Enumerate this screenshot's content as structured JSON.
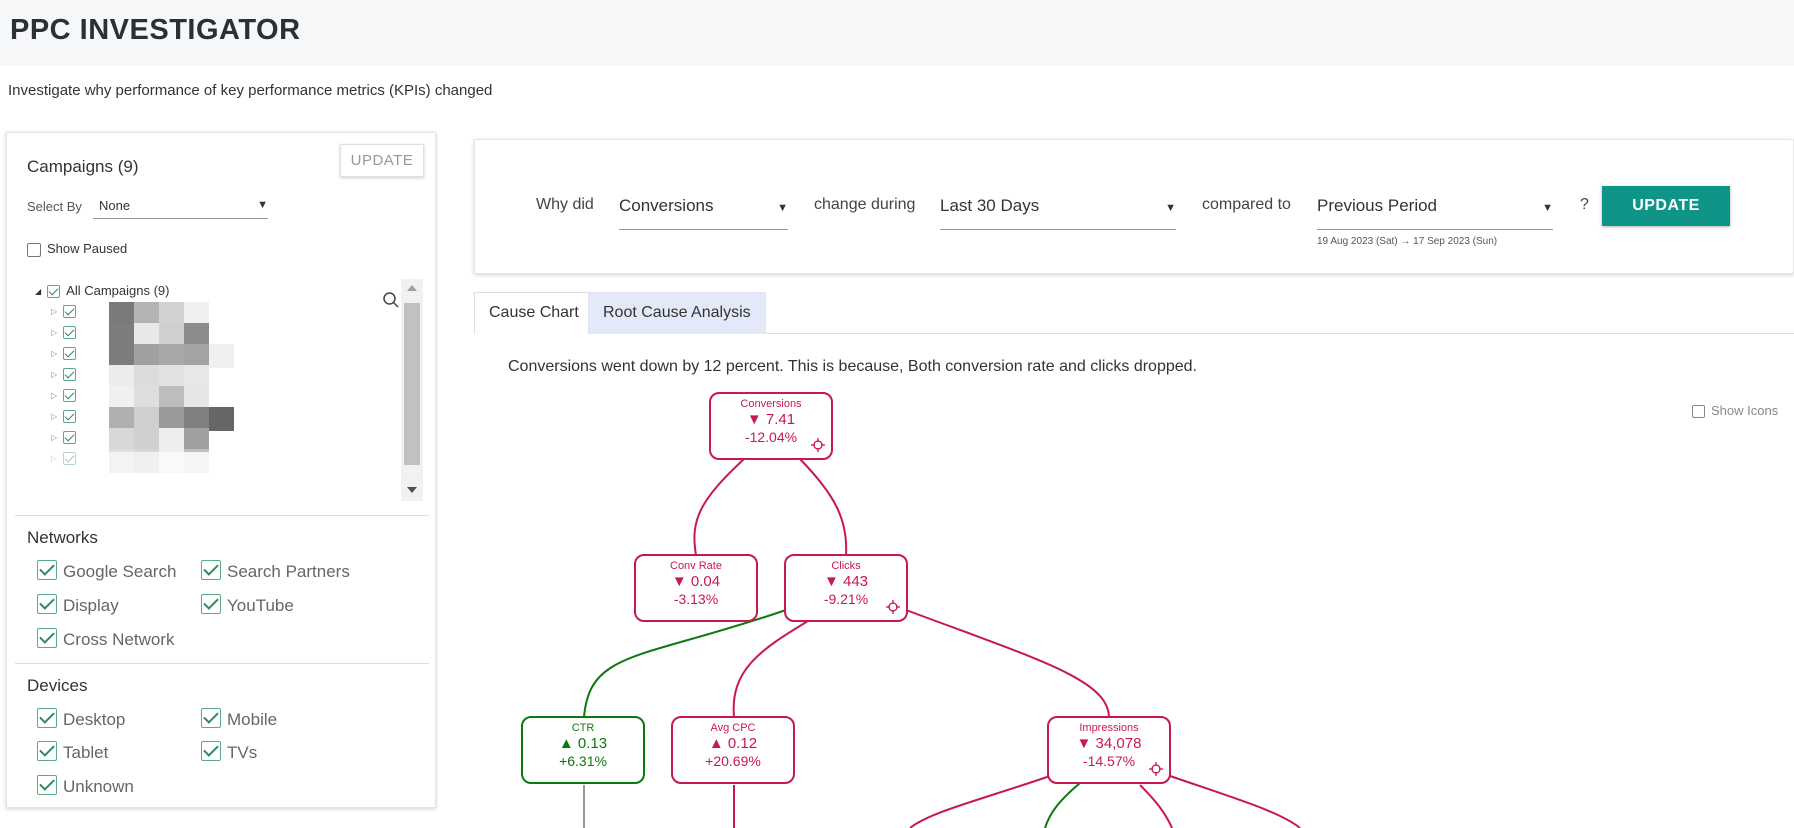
{
  "app": {
    "title": "PPC INVESTIGATOR",
    "subtitle": "Investigate why performance of key performance metrics (KPIs) changed"
  },
  "campaigns": {
    "title": "Campaigns (9)",
    "update_label": "UPDATE",
    "select_by_label": "Select By",
    "select_by_value": "None",
    "show_paused_label": "Show Paused",
    "root_label": "All Campaigns (9)",
    "search_icon": "search-icon"
  },
  "networks": {
    "title": "Networks",
    "items": [
      "Google Search",
      "Search Partners",
      "Display",
      "YouTube",
      "Cross Network"
    ]
  },
  "devices": {
    "title": "Devices",
    "items": [
      "Desktop",
      "Mobile",
      "Tablet",
      "TVs",
      "Unknown"
    ]
  },
  "query": {
    "why_did": "Why did",
    "metric": "Conversions",
    "change_during": "change during",
    "period": "Last 30 Days",
    "compared_to": "compared to",
    "comparison": "Previous Period",
    "question": "?",
    "date_range": "19 Aug 2023 (Sat) → 17 Sep 2023 (Sun)",
    "update_label": "UPDATE"
  },
  "tabs": [
    {
      "label": "Cause Chart",
      "active": true
    },
    {
      "label": "Root Cause Analysis",
      "active": false
    }
  ],
  "summary": "Conversions went down by 12 percent. This is because, Both conversion rate and clicks dropped.",
  "show_icons_label": "Show Icons",
  "colors": {
    "down": "#c8194c",
    "up": "#0d7a0d",
    "accent": "#0f9488"
  },
  "cause_tree": {
    "conversions": {
      "name": "Conversions",
      "value": "▼ 7.41",
      "pct": "-12.04%"
    },
    "conv_rate": {
      "name": "Conv Rate",
      "value": "▼ 0.04",
      "pct": "-3.13%"
    },
    "clicks": {
      "name": "Clicks",
      "value": "▼ 443",
      "pct": "-9.21%"
    },
    "ctr": {
      "name": "CTR",
      "value": "▲ 0.13",
      "pct": "+6.31%"
    },
    "avg_cpc": {
      "name": "Avg CPC",
      "value": "▲ 0.12",
      "pct": "+20.69%"
    },
    "impressions": {
      "name": "Impressions",
      "value": "▼ 34,078",
      "pct": "-14.57%"
    }
  }
}
